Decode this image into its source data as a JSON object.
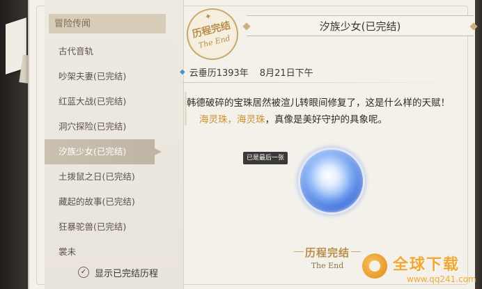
{
  "sidebar": {
    "header_label": "冒险传闻",
    "items": [
      {
        "label": "古代音轨"
      },
      {
        "label": "吵架夫妻(已完结)"
      },
      {
        "label": "红蓝大战(已完结)"
      },
      {
        "label": "洞穴探险(已完结)"
      },
      {
        "label": "汐族少女(已完结)"
      },
      {
        "label": "土拨鼠之日(已完结)"
      },
      {
        "label": "藏起的故事(已完结)"
      },
      {
        "label": "狂暴驼兽(已完结)"
      },
      {
        "label": "裳未"
      }
    ],
    "active_index": 4,
    "show_completed_label": "显示已完结历程",
    "show_completed_checked": true
  },
  "stamp": {
    "title": "历程完结",
    "subtitle": "The End"
  },
  "main": {
    "title": "汐族少女(已完结)",
    "date_era": "云垂历1393年",
    "date_day": "8月21日下午",
    "line1": "韩德破碎的宝珠居然被渲儿转眼间修复了，这是什么样的天赋！",
    "line2_hl1": "海灵珠",
    "line2_sep": "，",
    "line2_hl2": "海灵珠",
    "line2_rest": "，真像是美好守护的具象呢。",
    "tooltip": "已是最后一张",
    "end_title": "历程完结",
    "end_subtitle": "The End"
  },
  "watermark": {
    "title": "全球下载",
    "url": "www.qq241.com"
  },
  "colors": {
    "highlight": "#c89230",
    "panel": "#f4f1ea",
    "accent_gold": "#b88f4a"
  }
}
